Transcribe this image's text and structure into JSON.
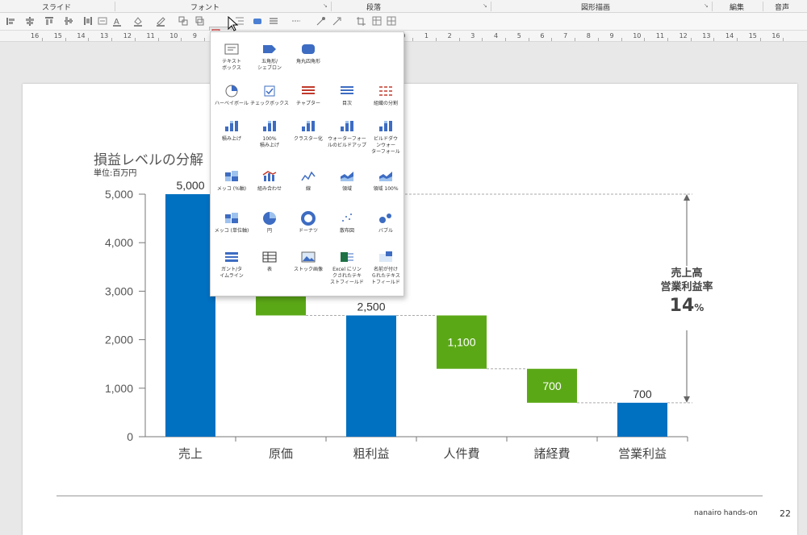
{
  "ribbon": {
    "groups": [
      "スライド",
      "フォント",
      "段落",
      "図形描画",
      "編集",
      "音声"
    ]
  },
  "ruler": {
    "numbers": [
      "16",
      "15",
      "14",
      "13",
      "12",
      "11",
      "10",
      "9",
      "8",
      "7",
      "6",
      "5",
      "4",
      "3",
      "2",
      "1",
      "0",
      "1",
      "2",
      "3",
      "4",
      "5",
      "6",
      "7",
      "8",
      "9",
      "10",
      "11",
      "12",
      "13",
      "14",
      "15",
      "16"
    ]
  },
  "menu": {
    "items": [
      [
        "テキスト",
        "ボックス"
      ],
      [
        "五角形/",
        "シェブロン"
      ],
      [
        "角丸四角形"
      ],
      [
        "ハーベイボール"
      ],
      [
        "チェックボックス"
      ],
      [
        "チャプター"
      ],
      [
        "目次"
      ],
      [
        "組織の分割"
      ],
      [
        "積み上げ"
      ],
      [
        "100%",
        "積み上げ"
      ],
      [
        "クラスター化"
      ],
      [
        "ウォーターフォー",
        "ルのビルドアップ"
      ],
      [
        "ビルドダウ",
        "ンウォー",
        "ターフォール"
      ],
      [
        "メッコ (%軸)"
      ],
      [
        "組み合わせ"
      ],
      [
        "線"
      ],
      [
        "領域"
      ],
      [
        "領域 100%"
      ],
      [
        "メッコ (単位軸)"
      ],
      [
        "円"
      ],
      [
        "ドーナツ"
      ],
      [
        "散布図"
      ],
      [
        "バブル"
      ],
      [
        "ガント/タ",
        "イムライン"
      ],
      [
        "表"
      ],
      [
        "ストック画像"
      ],
      [
        "Excel にリン",
        "クされたテキ",
        "ストフィールド"
      ],
      [
        "名前が付け",
        "られたテキス",
        "トフィールド"
      ]
    ]
  },
  "slide": {
    "title": "損益レベルの分解",
    "unit": "単位:百万円",
    "footer": "nanairo hands-on",
    "page_number": "22"
  },
  "callout": {
    "line1": "売上高",
    "line2": "営業利益率",
    "value": "14",
    "pct_sign": "%"
  },
  "colors": {
    "blue": "#0070c0",
    "green": "#5ba817"
  },
  "chart_data": {
    "type": "bar",
    "subtype": "waterfall",
    "categories": [
      "売上",
      "原価",
      "粗利益",
      "人件費",
      "諸経費",
      "営業利益"
    ],
    "values": [
      5000,
      2500,
      2500,
      1100,
      700,
      700
    ],
    "bar_kind": [
      "total",
      "decrease",
      "total",
      "decrease",
      "decrease",
      "total"
    ],
    "labels": [
      "5,000",
      "",
      "2,500",
      "1,100",
      "700",
      "700"
    ],
    "ylim": [
      0,
      5000
    ],
    "yticks": [
      "0",
      "1,000",
      "2,000",
      "3,000",
      "4,000",
      "5,000"
    ]
  }
}
